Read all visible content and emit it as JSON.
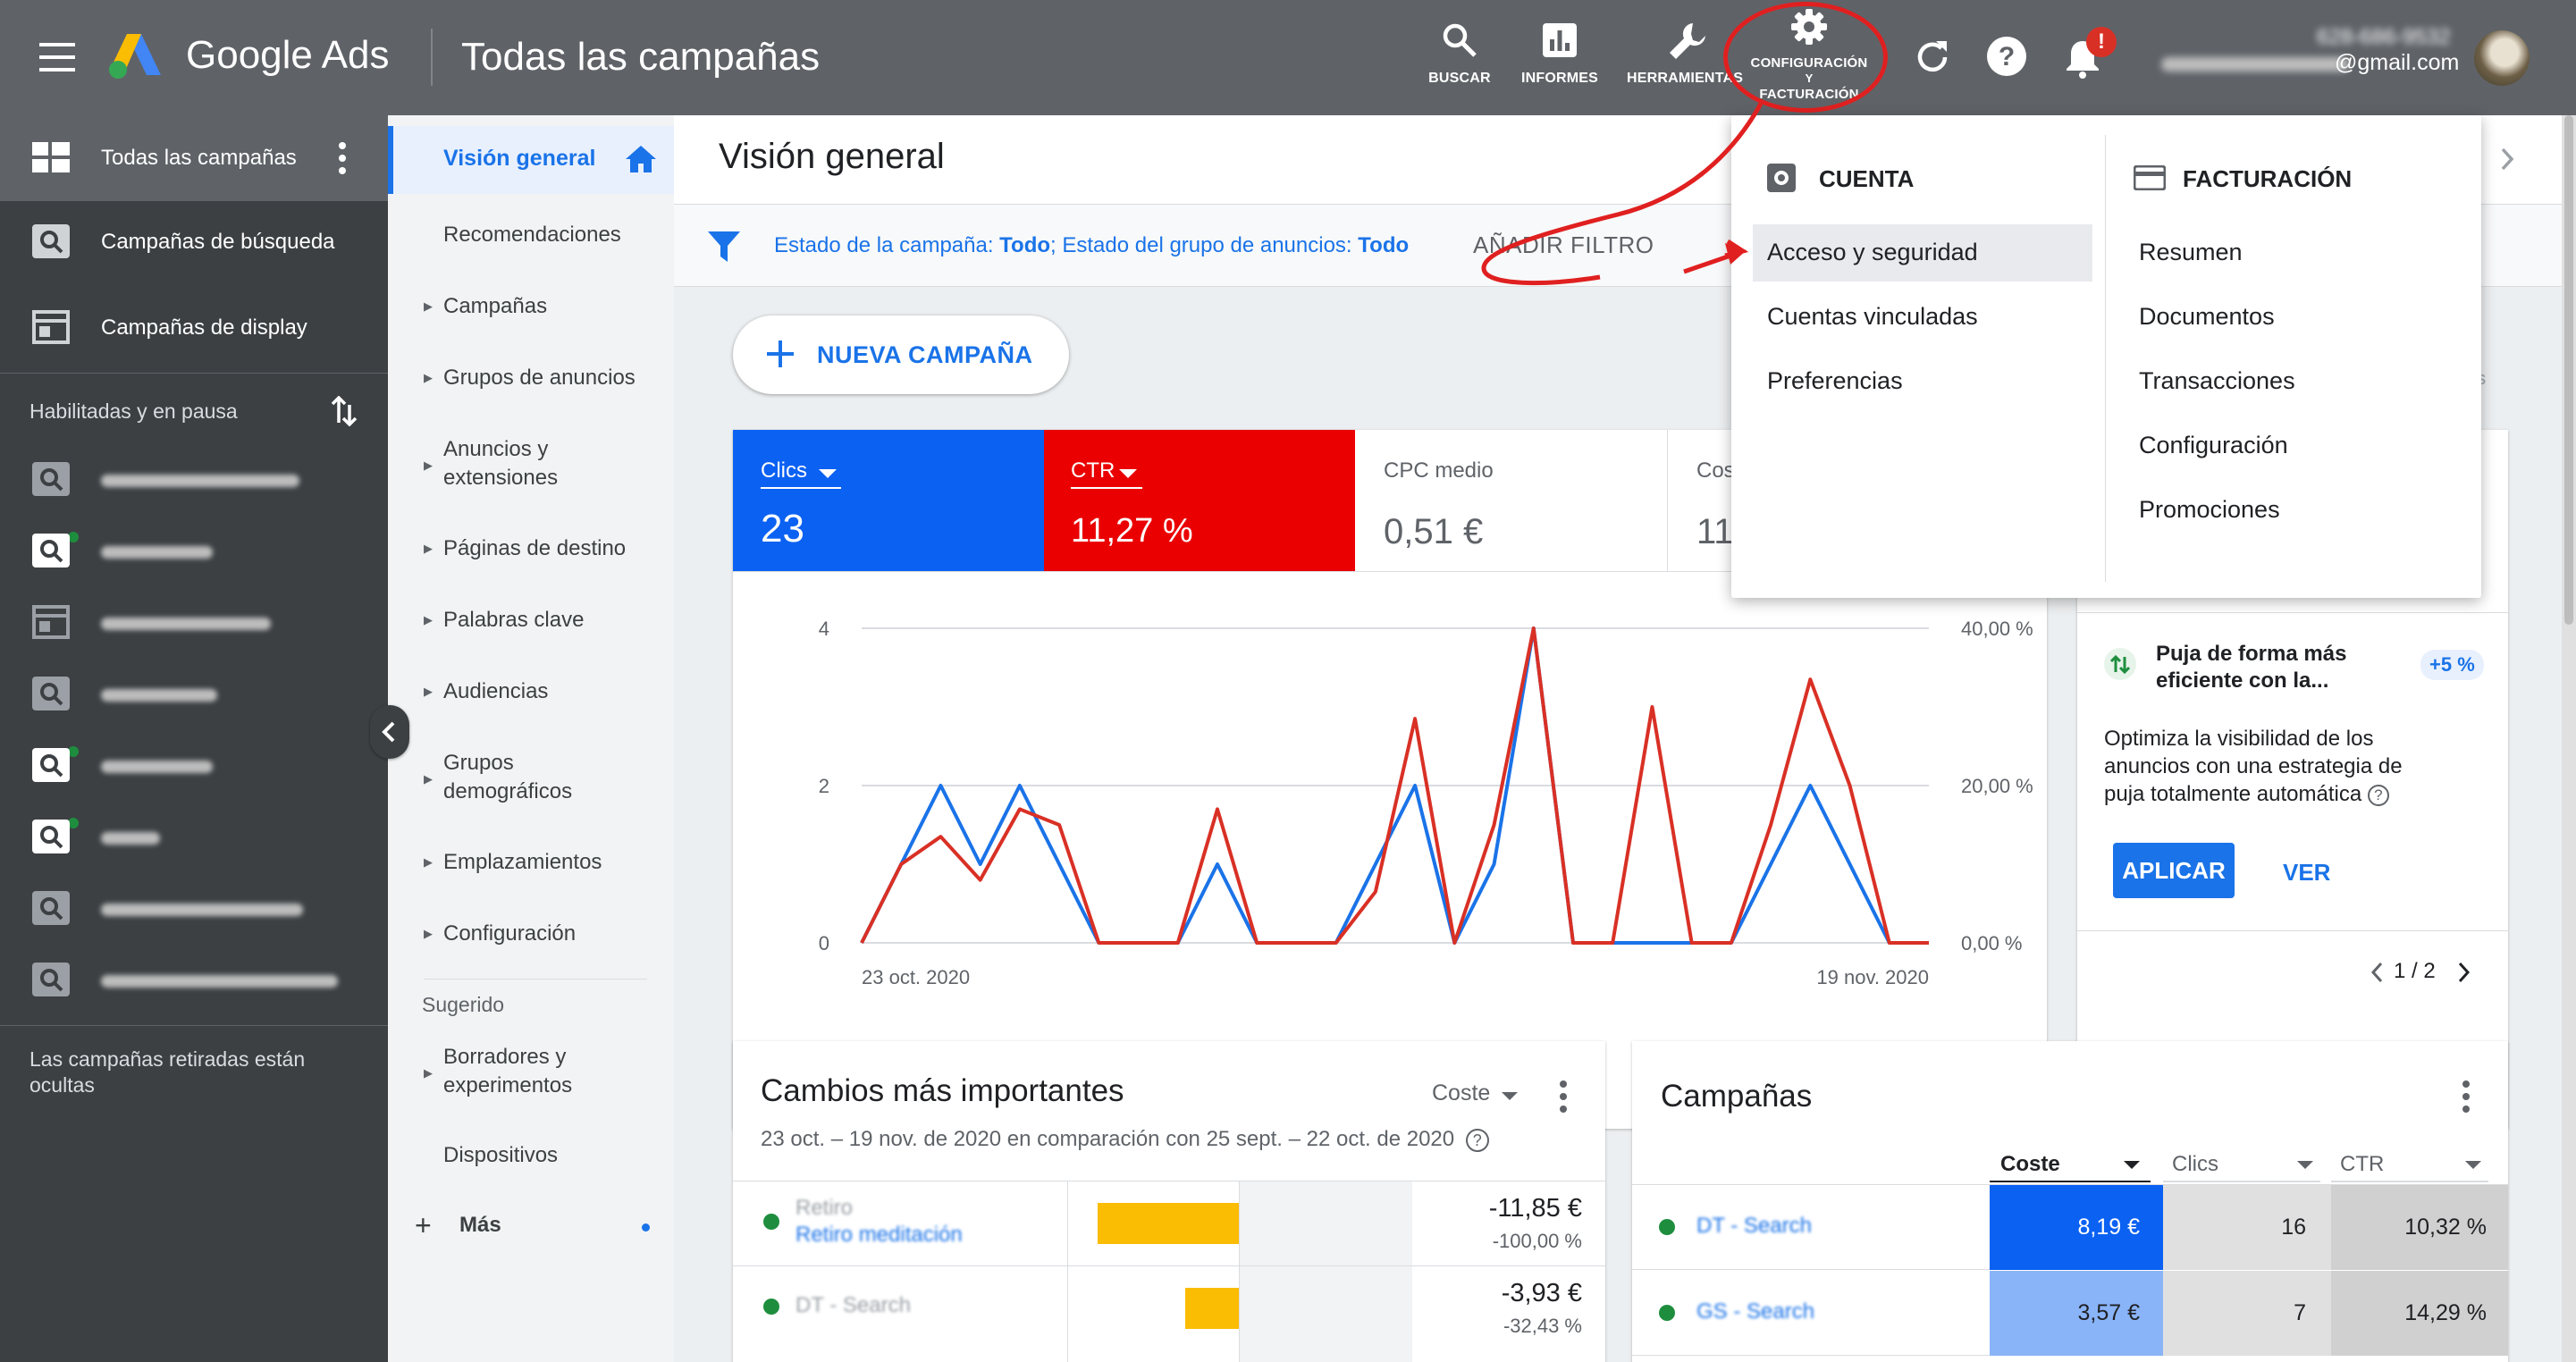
{
  "app": {
    "brand": "Google Ads",
    "page_title": "Todas las campañas"
  },
  "topnav": {
    "buscar": "BUSCAR",
    "informes": "INFORMES",
    "herramientas": "HERRAMIENTAS",
    "config_l1": "CONFIGURACIÓN",
    "config_l2": "Y",
    "config_l3": "FACTURACIÓN",
    "notification_badge": "!",
    "account_phone": "628-686-9532",
    "account_email": "@gmail.com"
  },
  "leftnav": {
    "all_campaigns": "Todas las campañas",
    "search_campaigns": "Campañas de búsqueda",
    "display_campaigns": "Campañas de display",
    "filter_label": "Habilitadas y en pausa",
    "retired_note": "Las campañas retiradas están ocultas"
  },
  "subnav": {
    "overview": "Visión general",
    "recommendations": "Recomendaciones",
    "campaigns": "Campañas",
    "ad_groups": "Grupos de anuncios",
    "ads_l1": "Anuncios y",
    "ads_l2": "extensiones",
    "landing": "Páginas de destino",
    "keywords": "Palabras clave",
    "audiences": "Audiencias",
    "demo_l1": "Grupos",
    "demo_l2": "demográficos",
    "placements": "Emplazamientos",
    "settings": "Configuración",
    "suggested": "Sugerido",
    "drafts_l1": "Borradores y",
    "drafts_l2": "experimentos",
    "devices": "Dispositivos",
    "more": "Más"
  },
  "main": {
    "heading": "Visión general",
    "filter_prefix": "Estado de la campaña: ",
    "filter_v1": "Todo",
    "filter_mid": "; Estado del grupo de anuncios: ",
    "filter_v2": "Todo",
    "add_filter": "AÑADIR FILTRO",
    "new_campaign": "NUEVA CAMPAÑA",
    "side_hint": "os"
  },
  "kpis": {
    "clicks_label": "Clics",
    "clicks_value": "23",
    "ctr_label": "CTR",
    "ctr_value": "11,27 %",
    "cpc_label": "CPC medio",
    "cpc_value": "0,51 €",
    "cost_label": "Cos",
    "cost_value": "11"
  },
  "chart_data": {
    "type": "line",
    "x_start_label": "23 oct. 2020",
    "x_end_label": "19 nov. 2020",
    "left_axis_ticks": [
      "0",
      "2",
      "4"
    ],
    "right_axis_ticks": [
      "0,00 %",
      "20,00 %",
      "40,00 %"
    ],
    "ylim_left": [
      0,
      4
    ],
    "ylim_right": [
      0,
      40
    ],
    "series": [
      {
        "name": "Clics",
        "color": "#1a73e8",
        "values": [
          0,
          1,
          2,
          1,
          2,
          1,
          0,
          0,
          0,
          1,
          0,
          0,
          0,
          1,
          2,
          0,
          1,
          4,
          0,
          0,
          0,
          0,
          0,
          1,
          2,
          1,
          0,
          0
        ]
      },
      {
        "name": "CTR",
        "color": "#d93025",
        "values": [
          0,
          10,
          13.5,
          8,
          17,
          15,
          0,
          0,
          0,
          17,
          0,
          0,
          0,
          6.5,
          28.5,
          0,
          15,
          40,
          0,
          0,
          30,
          0,
          0,
          15,
          33.5,
          20,
          0,
          0
        ]
      }
    ]
  },
  "reco": {
    "title_l1": "Puja de forma más",
    "title_l2": "eficiente con la...",
    "badge": "+5 %",
    "body_l1": "Optimiza la visibilidad de los",
    "body_l2": "anuncios con una estrategia de",
    "body_l3": "puja totalmente automática",
    "apply": "APLICAR",
    "view": "VER",
    "pager": "1 / 2"
  },
  "changes": {
    "title": "Cambios más importantes",
    "metric": "Coste",
    "subtitle": "23 oct. – 19 nov. de 2020 en comparación con 25 sept. – 22 oct. de 2020",
    "rows": [
      {
        "name": "Retiro",
        "sub": "Retiro meditación",
        "value": "-11,85 €",
        "pct": "-100,00 %",
        "bar": 1.0
      },
      {
        "name": "DT - Search",
        "sub": "",
        "value": "-3,93 €",
        "pct": "-32,43 %",
        "bar": 0.38
      }
    ]
  },
  "campaigns_card": {
    "title": "Campañas",
    "col_cost": "Coste",
    "col_clicks": "Clics",
    "col_ctr": "CTR",
    "rows": [
      {
        "name": "DT - Search",
        "cost": "8,19 €",
        "clicks": "16",
        "ctr": "10,32 %"
      },
      {
        "name": "GS - Search",
        "cost": "3,57 €",
        "clicks": "7",
        "ctr": "14,29 %"
      }
    ]
  },
  "dropdown": {
    "account_header": "CUENTA",
    "billing_header": "FACTURACIÓN",
    "account_items": [
      "Acceso y seguridad",
      "Cuentas vinculadas",
      "Preferencias"
    ],
    "billing_items": [
      "Resumen",
      "Documentos",
      "Transacciones",
      "Configuración",
      "Promociones"
    ]
  },
  "colors": {
    "topbar": "#5f6368",
    "leftnav": "#3c4043",
    "accent_blue": "#1a73e8",
    "kpi_red": "#ea0000",
    "kpi_blue": "#0b61f2",
    "annotation_red": "#e02020",
    "bar_yellow": "#fbbc04"
  }
}
